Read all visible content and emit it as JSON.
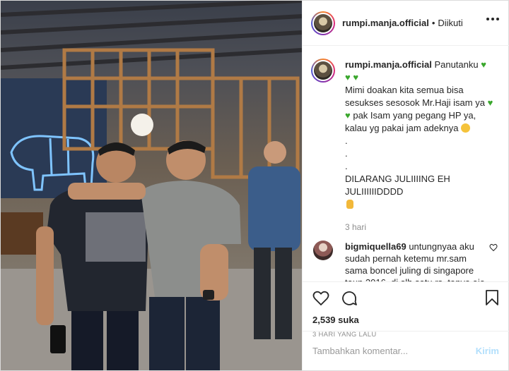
{
  "post": {
    "username": "rumpi.manja.official",
    "dot": "•",
    "follow_status": "Diikuti",
    "caption_user": "rumpi.manja.official",
    "caption_lines": [
      "Panutanku",
      "Mimi doakan kita semua bisa sesukses sesosok Mr.Haji isam ya",
      "pak Isam yang pegang HP ya, kalau yg pakai jam adeknya",
      ".",
      ".",
      ".",
      "DILARANG JULIIIING EH JULIIIIIIDDDD"
    ],
    "caption_time": "3 hari",
    "comment": {
      "user": "bigmiquella69",
      "text": "untungnyaa aku sudah pernah ketemu mr.sam sama boncel juling di singapore taun 2016, di slh satu rs, tanya aja ke slh satu perawatndi rs tsb ada kok yg org indo kerja disitu jg"
    },
    "likes": "2,539 suka",
    "date": "3 HARI YANG LALU",
    "comment_placeholder": "Tambahkan komentar...",
    "post_button": "Kirim"
  },
  "colors": {
    "heart_emoji": "#3aa72d",
    "post_button": "#b2dffc",
    "secondary_text": "#8e8e8e"
  },
  "icons": [
    "more-options-icon",
    "like-heart-icon",
    "comment-icon",
    "bookmark-icon",
    "comment-like-icon",
    "green-heart-emoji",
    "smile-emoji",
    "hand-emoji"
  ]
}
